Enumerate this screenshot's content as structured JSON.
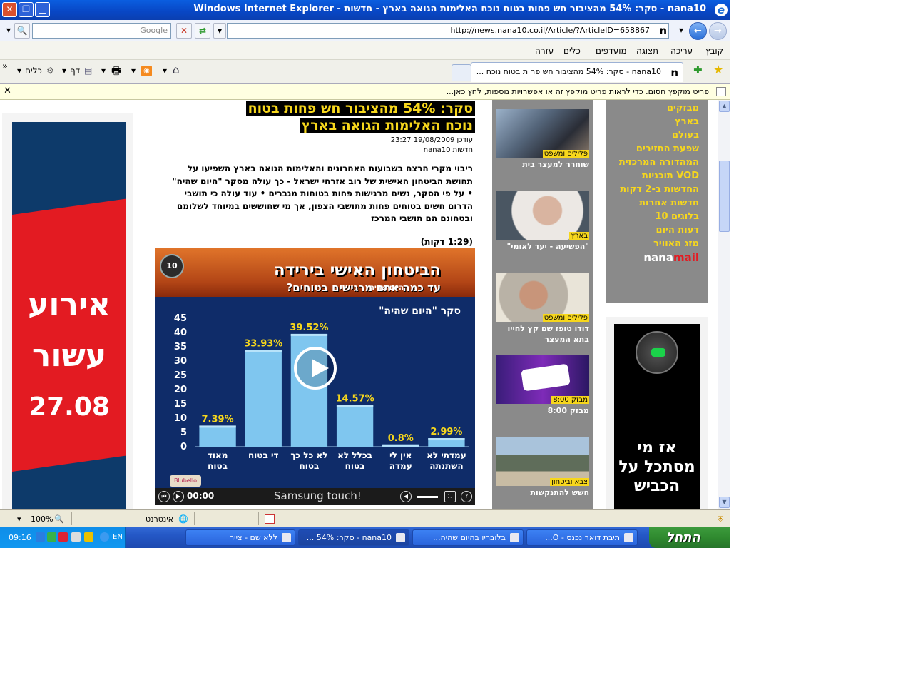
{
  "window": {
    "title": "nana10 - סקר: 54% מהציבור חש פחות בטוח נוכח האלימות הגואה בארץ - חדשות - Windows Internet Explorer"
  },
  "address_bar": {
    "url": "http://news.nana10.co.il/Article/?ArticleID=658867",
    "search_placeholder": "Google"
  },
  "menu": [
    "קובץ",
    "עריכה",
    "תצוגה",
    "מועדפים",
    "כלים",
    "עזרה"
  ],
  "tab": {
    "title": "nana10 - סקר: 54% מהציבור חש פחות בטוח נוכח ..."
  },
  "toolbar": {
    "page_label": "דף",
    "tools_label": "כלים",
    "more": "»"
  },
  "info_bar": {
    "text": "פריט מוקפץ חסום. כדי לראות פריט מוקפץ זה או אפשרויות נוספות, לחץ כאן..."
  },
  "left_ad": {
    "line1": "אירוע",
    "line2": "עשור",
    "line3": "27.08"
  },
  "article": {
    "headline_line1": "סקר: 54% מהציבור חש פחות בטוח",
    "headline_line2": "נוכח האלימות הגואה בארץ",
    "updated": "עודכן 19/08/2009 23:27",
    "source": "חדשות nana10",
    "lead": "ריבוי מקרי הרצח בשבועות האחרונים והאלימות הגואה בארץ השפיעו על תחושת הביטחון האישית של רוב אזרחי ישראל - כך עולה מסקר \"היום שהיה\" • על פי הסקר, נשים מרגישות פחות בטוחות מגברים • עוד עולה כי תושבי הדרום חשים בטוחים פחות מתושבי הצפון, אך מי שחוששים במיוחד לשלומם ובטחונם הם תושבי המרכז",
    "duration": "(1:29 דקות)"
  },
  "video": {
    "channel_logo": "10",
    "title": "הביטחון האישי בירידה",
    "subtitle": "עד כמה אתם מרגישים בטוחים?",
    "show_tag": "היום שהיה",
    "survey_label": "סקר \"היום שהיה\"",
    "time": "00:00",
    "brand": "Samsung  touch!",
    "corner_logo": "Blubello"
  },
  "chart_data": {
    "type": "bar",
    "categories": [
      "מאוד בטוח",
      "די בטוח",
      "לא כל כך בטוח",
      "בכלל לא בטוח",
      "אין לי עמדה",
      "עמדתי לא השתנתה"
    ],
    "values": [
      7.39,
      33.93,
      39.52,
      14.57,
      0.8,
      2.99
    ],
    "value_labels": [
      "7.39%",
      "33.93%",
      "39.52%",
      "14.57%",
      "0.8%",
      "2.99%"
    ],
    "y_ticks": [
      0,
      5,
      10,
      15,
      20,
      25,
      30,
      35,
      40,
      45
    ],
    "ylim": [
      0,
      45
    ],
    "colors": {
      "bar": "#7fc6ef",
      "bar_top": "#b8e3fa",
      "label": "#f7d71c",
      "background": "#0f2c69"
    }
  },
  "related": [
    {
      "category": "פלילים ומשפט",
      "title": "שוחרר למעצר בית"
    },
    {
      "category": "בארץ",
      "title": "\"הפשיעה - יעד לאומי\""
    },
    {
      "category": "פלילים ומשפט",
      "title": "דודו טופז שם קץ לחייו בתא המעצר"
    },
    {
      "category": "מבזק 8:00",
      "title": "מבזק 8:00"
    },
    {
      "category": "צבא וביטחון",
      "title": "חשש להתנקשות"
    }
  ],
  "nav": [
    "מבזקים",
    "בארץ",
    "בעולם",
    "שפעת החזירים",
    "המהדורה המרכזית",
    "VOD תוכניות",
    "החדשות ב-2 דקות",
    "חדשות אחרות",
    "בלוגים 10",
    "דעות היום",
    "מזג האוויר"
  ],
  "nanamail": {
    "part1": "nana",
    "part2": "mail"
  },
  "right_ad": {
    "text": "אז מי מסתכל על הכביש"
  },
  "status_bar": {
    "zone": "אינטרנט",
    "zoom": "100%"
  },
  "taskbar": {
    "start": "התחל",
    "tasks": [
      "תיבת דואר נכנס - O...",
      "בלובריו בהיום שהיה...",
      "nana10 - סקר: 54% ...",
      "ללא שם - צייר"
    ],
    "clock": "09:16",
    "lang": "EN"
  },
  "colors": {
    "accent_yellow": "#f7d71c",
    "nav_gray": "#8a8a8a",
    "nanamail_red": "#e31b22"
  }
}
